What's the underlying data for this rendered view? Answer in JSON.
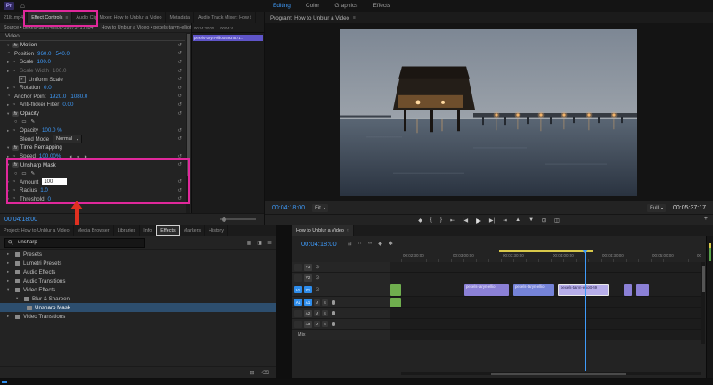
{
  "colors": {
    "accent_blue": "#3f9bfa",
    "highlight_pink": "#e0289b",
    "arrow_red": "#e03020",
    "clip_purple": "#8b80d6",
    "clip_blue": "#7583d8",
    "clip_selected": "#b7aeea",
    "clip_green": "#6fae4e",
    "workarea_yellow": "#d8c84a"
  },
  "icons": {
    "menu": "≡",
    "close": "×",
    "home": "⌂",
    "chev_r": "▸",
    "chev_d": "▾",
    "stopwatch": "◔",
    "reset": "↺",
    "fx": "fx",
    "mask_ellipse": "○",
    "mask_rect": "▭",
    "mask_pen": "✎",
    "kf_prev": "◀",
    "kf_add": "◆",
    "kf_next": "▶",
    "dropdown": "▾",
    "add_marker": "◆",
    "mark_in": "{",
    "mark_out": "}",
    "go_in": "⇤",
    "step_back": "|◀",
    "play": "▶",
    "step_fwd": "▶|",
    "go_out": "⇥",
    "lift": "▲",
    "extract": "▼",
    "export_frame": "⊡",
    "compare": "◫",
    "plus": "+",
    "eye": "⊙",
    "snap": "∩",
    "linked": "∞",
    "nest": "⊟",
    "settings": "✱",
    "sel_tool": "▶",
    "track_tool": "⊞",
    "ripple_tool": "⇄",
    "razor_tool": "✂",
    "slip_tool": "↔",
    "pen_tool": "✎",
    "hand_tool": "⊕",
    "type_tool": "T",
    "badge_a": "▦",
    "badge_b": "◨",
    "new_bin": "⊞",
    "trash": "⌫",
    "list_view": "≣"
  },
  "top_bar": {
    "logo": "Pr",
    "workspaces": [
      {
        "label": "Editing"
      },
      {
        "label": "Color"
      },
      {
        "label": "Graphics"
      },
      {
        "label": "Effects"
      }
    ]
  },
  "effect_controls": {
    "tabs": {
      "clip": "21lb.mp4",
      "items": [
        "Effect Controls",
        "Audio Clip Mixer: How to Unblur a Video",
        "Metadata",
        "Audio Track Mixer: How t"
      ]
    },
    "source_left": "Source • pexels-taryn-elliott-5937571.mp4",
    "source_right": "How to Unblur a Video • pexels-taryn-elliott-59...",
    "ruler": [
      "00:04:30:00",
      "00:04:4"
    ],
    "clip_chip": "pexels-taryn-elliott-5937571...",
    "section_video": "Video",
    "motion_label": "Motion",
    "position": {
      "label": "Position",
      "x": "960.0",
      "y": "540.0"
    },
    "scale": {
      "label": "Scale",
      "value": "100.0"
    },
    "scale_width": {
      "label": "Scale Width",
      "value": "100.0"
    },
    "uniform_scale_label": "Uniform Scale",
    "uniform_scale_check": "✓",
    "rotation": {
      "label": "Rotation",
      "value": "0.0"
    },
    "anchor": {
      "label": "Anchor Point",
      "x": "1920.0",
      "y": "1080.0"
    },
    "antiflicker": {
      "label": "Anti-flicker Filter",
      "value": "0.00"
    },
    "opacity_label": "Opacity",
    "opacity": {
      "label": "Opacity",
      "value": "100.0 %"
    },
    "blend": {
      "label": "Blend Mode",
      "value": "Normal"
    },
    "time_remap_label": "Time Remapping",
    "speed": {
      "label": "Speed",
      "value": "100.00%"
    },
    "unsharp_label": "Unsharp Mask",
    "amount": {
      "label": "Amount",
      "value": "100"
    },
    "radius": {
      "label": "Radius",
      "value": "1.0"
    },
    "threshold": {
      "label": "Threshold",
      "value": "0"
    },
    "timecode": "00:04:18:00"
  },
  "program": {
    "title": "Program: How to Unblur a Video",
    "timecode": "00:04:18:00",
    "fit": "Fit",
    "resolution": "Full",
    "duration": "00:05:37:17"
  },
  "project": {
    "tabs": [
      "Project: How to Unblur a Video",
      "Media Browser",
      "Libraries",
      "Info",
      "Effects",
      "Markers",
      "History"
    ],
    "search_value": "unsharp",
    "tree": [
      {
        "chev": "▸",
        "label": "Presets"
      },
      {
        "chev": "▸",
        "label": "Lumetri Presets"
      },
      {
        "chev": "▸",
        "label": "Audio Effects"
      },
      {
        "chev": "▸",
        "label": "Audio Transitions"
      },
      {
        "chev": "▾",
        "label": "Video Effects"
      },
      {
        "chev": "▾",
        "label": "Blur & Sharpen"
      },
      {
        "chev": "",
        "label": "Unsharp Mask"
      },
      {
        "chev": "▸",
        "label": "Video Transitions"
      }
    ]
  },
  "timeline": {
    "tab": "How to Unblur a Video",
    "timecode": "00:04:18:00",
    "ruler": [
      "00:02:30:00",
      "00:03:00:00",
      "00:03:30:00",
      "00:04:00:00",
      "00:04:30:00",
      "00:05:00:00",
      "00:05:3"
    ],
    "video_tracks": [
      "V3",
      "V2",
      "V1"
    ],
    "audio_tracks": [
      "A1",
      "A2",
      "A3"
    ],
    "mix_label": "Mix",
    "mute": "M",
    "solo": "S",
    "clips": {
      "c1": "pexels-taryn-ellio",
      "c2": "pexels-taryn-ellio",
      "c3": "pexels-taryn-elliott-59"
    }
  }
}
